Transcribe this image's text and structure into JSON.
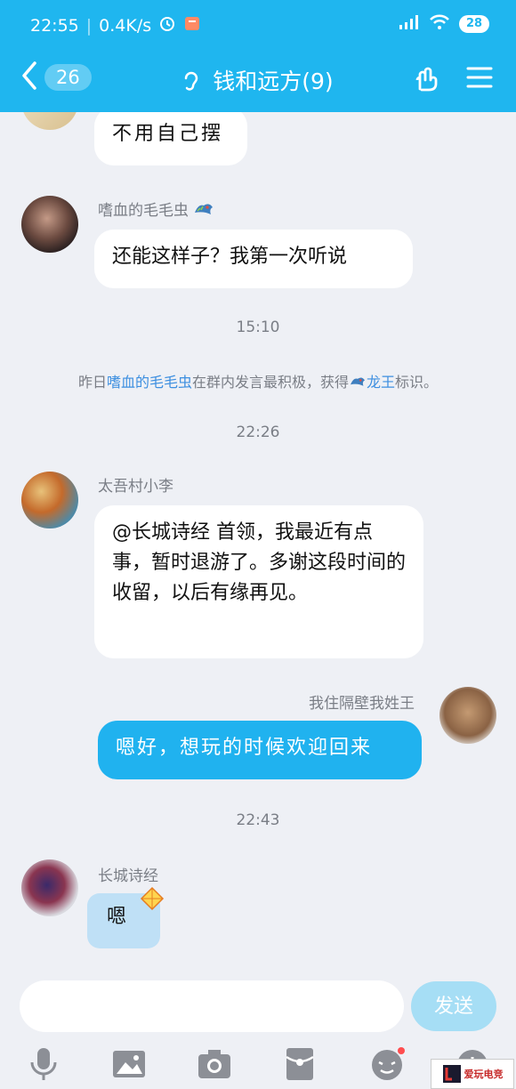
{
  "status_bar": {
    "time": "22:55",
    "speed": "0.4K/s",
    "battery": "28"
  },
  "header": {
    "back_count": "26",
    "title": "钱和远方(9)"
  },
  "messages": {
    "m0_text": "不用自己摆",
    "m1_nick": "嗜血的毛毛虫",
    "m1_text": "还能这样子？我第一次听说",
    "time1": "15:10",
    "sys_prefix": "昨日",
    "sys_name": "嗜血的毛毛虫",
    "sys_middle": "在群内发言最积极，获得",
    "sys_title": "龙王",
    "sys_suffix": "标识。",
    "time2": "22:26",
    "m2_nick": "太吾村小李",
    "m2_text": "@长城诗经 首领，我最近有点事，暂时退游了。多谢这段时间的收留，以后有缘再见。",
    "m3_nick": "我住隔壁我姓王",
    "m3_text": "嗯好，想玩的时候欢迎回来",
    "time3": "22:43",
    "m4_nick": "长城诗经",
    "m4_text": "嗯"
  },
  "composer": {
    "input_value": "",
    "send_label": "发送"
  },
  "watermark": {
    "text": "爱玩电竞"
  },
  "colors": {
    "accent": "#1fb6ef",
    "bubble_self": "#20b2ef",
    "background": "#eef0f5",
    "link": "#3d8fe0"
  }
}
